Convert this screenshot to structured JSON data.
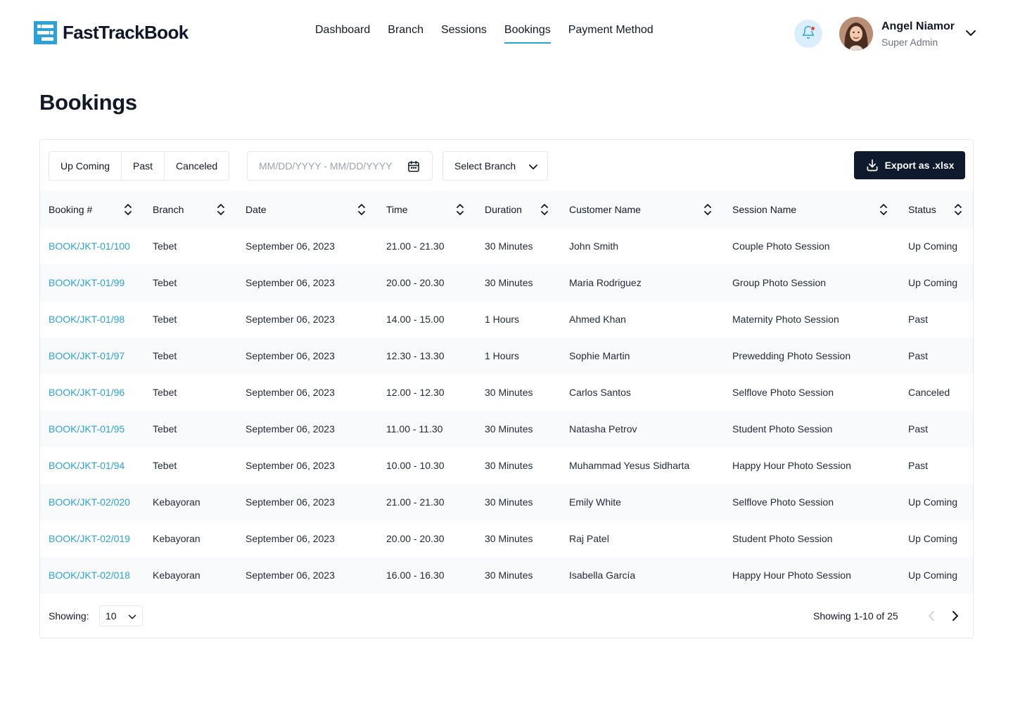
{
  "brand": {
    "name": "FastTrackBook",
    "accent": "#2ba3d9",
    "dark": "#0f1a2e"
  },
  "nav": {
    "items": [
      {
        "label": "Dashboard",
        "active": false
      },
      {
        "label": "Branch",
        "active": false
      },
      {
        "label": "Sessions",
        "active": false
      },
      {
        "label": "Bookings",
        "active": true
      },
      {
        "label": "Payment Method",
        "active": false
      }
    ]
  },
  "user": {
    "name": "Angel Niamor",
    "role": "Super Admin",
    "notification_icon": "bell-icon",
    "has_unread": true
  },
  "page": {
    "title": "Bookings"
  },
  "filters": {
    "tabs": [
      "Up Coming",
      "Past",
      "Canceled"
    ],
    "date_placeholder": "MM/DD/YYYY - MM/DD/YYYY",
    "branch_label": "Select Branch",
    "export_label": "Export as .xlsx"
  },
  "table": {
    "columns": [
      "Booking #",
      "Branch",
      "Date",
      "Time",
      "Duration",
      "Customer Name",
      "Session Name",
      "Status"
    ],
    "rows": [
      [
        "BOOK/JKT-01/100",
        "Tebet",
        "September 06, 2023",
        "21.00 - 21.30",
        "30 Minutes",
        "John Smith",
        "Couple Photo Session",
        "Up Coming"
      ],
      [
        "BOOK/JKT-01/99",
        "Tebet",
        "September 06, 2023",
        "20.00 - 20.30",
        "30 Minutes",
        "Maria Rodriguez",
        "Group Photo Session",
        "Up Coming"
      ],
      [
        "BOOK/JKT-01/98",
        "Tebet",
        "September 06, 2023",
        "14.00 - 15.00",
        "1 Hours",
        "Ahmed Khan",
        "Maternity Photo Session",
        "Past"
      ],
      [
        "BOOK/JKT-01/97",
        "Tebet",
        "September 06, 2023",
        "12.30 - 13.30",
        "1 Hours",
        "Sophie Martin",
        "Prewedding Photo Session",
        "Past"
      ],
      [
        "BOOK/JKT-01/96",
        "Tebet",
        "September 06, 2023",
        "12.00 - 12.30",
        "30 Minutes",
        "Carlos Santos",
        "Selflove Photo Session",
        "Canceled"
      ],
      [
        "BOOK/JKT-01/95",
        "Tebet",
        "September 06, 2023",
        "11.00 - 11.30",
        "30 Minutes",
        "Natasha Petrov",
        "Student Photo Session",
        "Past"
      ],
      [
        "BOOK/JKT-01/94",
        "Tebet",
        "September 06, 2023",
        "10.00 - 10.30",
        "30 Minutes",
        "Muhammad Yesus Sidharta",
        "Happy Hour Photo Session",
        "Past"
      ],
      [
        "BOOK/JKT-02/020",
        "Kebayoran",
        "September 06, 2023",
        "21.00 - 21.30",
        "30 Minutes",
        "Emily White",
        "Selflove Photo Session",
        "Up Coming"
      ],
      [
        "BOOK/JKT-02/019",
        "Kebayoran",
        "September 06, 2023",
        "20.00 - 20.30",
        "30 Minutes",
        "Raj Patel",
        "Student Photo Session",
        "Up Coming"
      ],
      [
        "BOOK/JKT-02/018",
        "Kebayoran",
        "September 06, 2023",
        "16.00 - 16.30",
        "30 Minutes",
        "Isabella García",
        "Happy Hour Photo Session",
        "Up Coming"
      ]
    ]
  },
  "pagination": {
    "showing_label": "Showing:",
    "page_size": "10",
    "range_text": "Showing 1-10 of 25"
  }
}
